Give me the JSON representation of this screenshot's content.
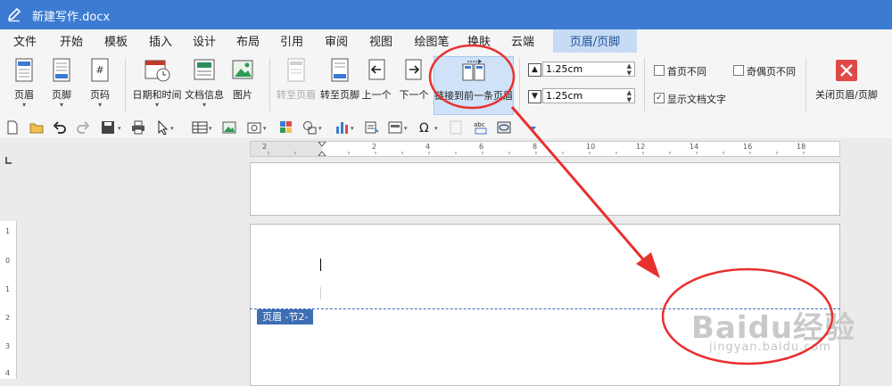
{
  "window": {
    "title": "新建写作.docx"
  },
  "menu": {
    "items": [
      "文件",
      "开始",
      "模板",
      "插入",
      "设计",
      "布局",
      "引用",
      "审阅",
      "视图",
      "绘图笔",
      "换肤",
      "云端"
    ],
    "active_tab": "页眉/页脚"
  },
  "ribbon": {
    "header_btn": "页眉",
    "footer_btn": "页脚",
    "page_num_btn": "页码",
    "datetime_btn": "日期和时间",
    "docinfo_btn": "文档信息",
    "picture_btn": "图片",
    "goto_header_btn": "转至页眉",
    "goto_footer_btn": "转至页脚",
    "prev_btn": "上一个",
    "next_btn": "下一个",
    "link_prev_btn": "链接到前一条页眉",
    "header_distance": "1.25cm",
    "footer_distance": "1.25cm",
    "diff_first_page": "首页不同",
    "diff_odd_even": "奇偶页不同",
    "show_doc_text": "显示文档文字",
    "close_btn": "关闭页眉/页脚"
  },
  "ruler": {
    "h_labels": [
      "2",
      "",
      "2",
      "4",
      "6",
      "8",
      "10",
      "12",
      "14",
      "16",
      "18"
    ],
    "v_labels": [
      "1",
      "0",
      "1",
      "2",
      "3",
      "4"
    ]
  },
  "document": {
    "header_tag": "页眉 -节2-"
  },
  "watermark": {
    "text": "Baidu经验",
    "sub": "jingyan.baidu.com"
  },
  "colors": {
    "title_bar": "#3c7bd1",
    "active_tab": "#c6dcf5",
    "annotation": "#e8302f",
    "header_tag": "#3d6eb4"
  }
}
